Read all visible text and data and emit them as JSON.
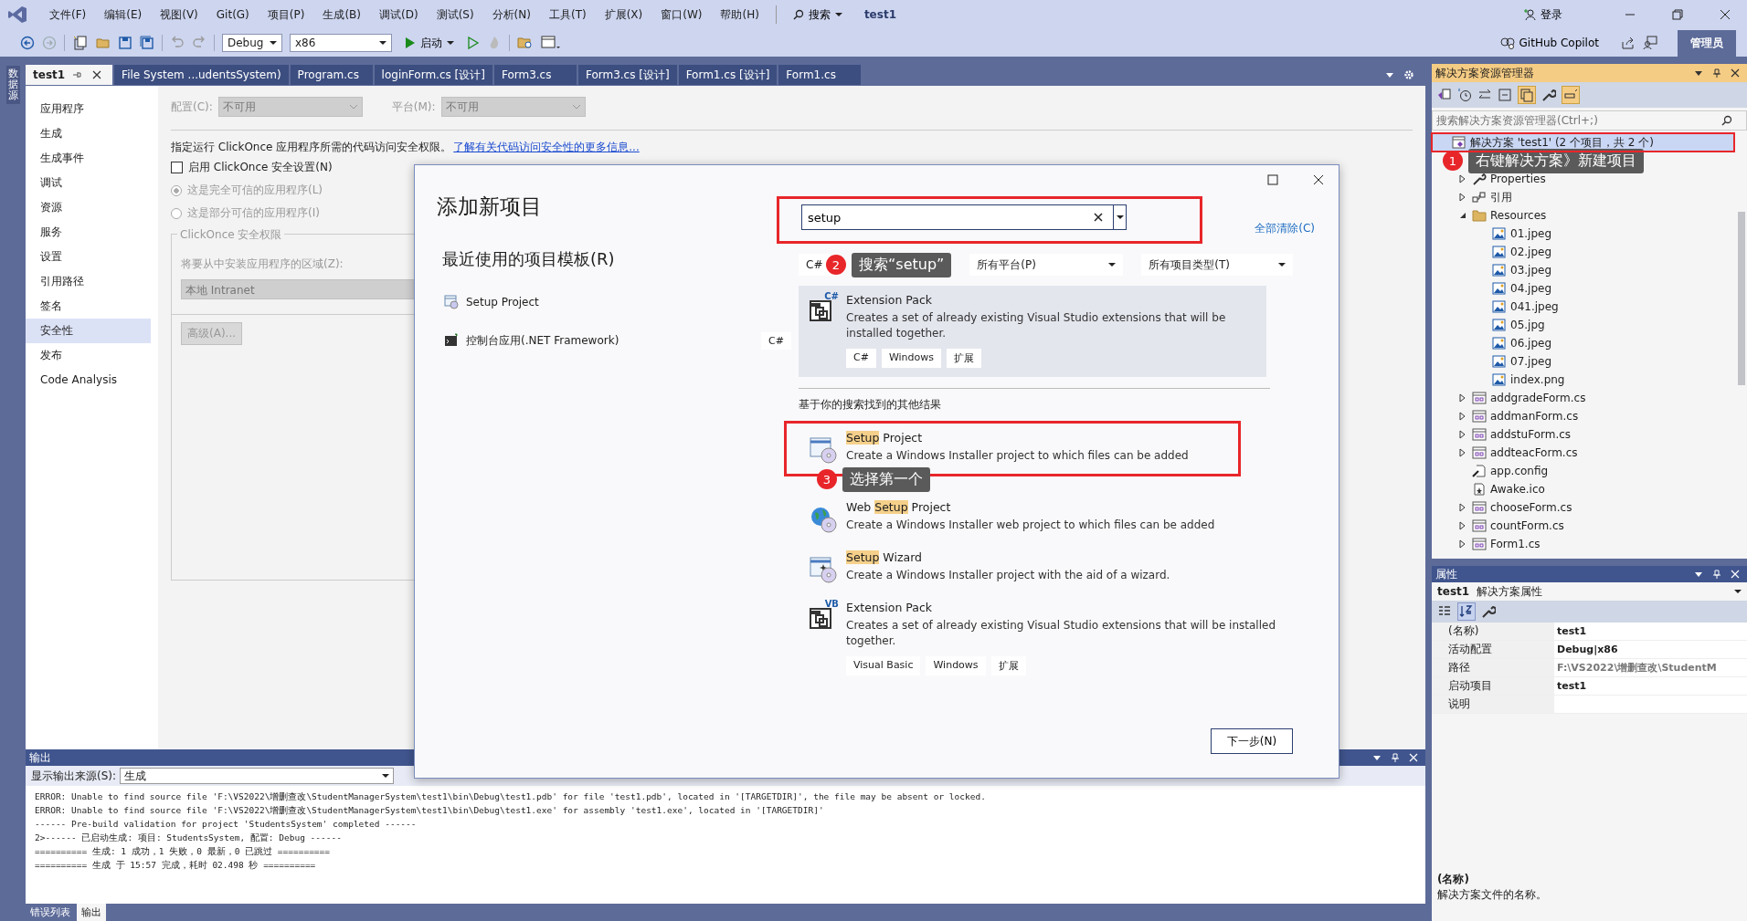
{
  "title_bar": {
    "menu": [
      "文件(F)",
      "编辑(E)",
      "视图(V)",
      "Git(G)",
      "项目(P)",
      "生成(B)",
      "调试(D)",
      "测试(S)",
      "分析(N)",
      "工具(T)",
      "扩展(X)",
      "窗口(W)",
      "帮助(H)"
    ],
    "search": "搜索",
    "solution_name": "test1",
    "sign_in": "登录"
  },
  "toolbar": {
    "configuration": "Debug",
    "platform": "x86",
    "start": "启动",
    "copilot": "GitHub Copilot",
    "admin": "管理员"
  },
  "side_strip": {
    "label": "数据源"
  },
  "document_tabs": [
    {
      "label": "test1",
      "selected": true
    },
    {
      "label": "File System ...udentsSystem)",
      "selected": false
    },
    {
      "label": "Program.cs",
      "selected": false
    },
    {
      "label": "loginForm.cs [设计]",
      "selected": false
    },
    {
      "label": "Form3.cs",
      "selected": false
    },
    {
      "label": "Form3.cs [设计]",
      "selected": false
    },
    {
      "label": "Form1.cs [设计]",
      "selected": false
    },
    {
      "label": "Form1.cs",
      "selected": false
    }
  ],
  "project_properties": {
    "nav": [
      {
        "label": "应用程序",
        "selected": false
      },
      {
        "label": "生成",
        "selected": false
      },
      {
        "label": "生成事件",
        "selected": false
      },
      {
        "label": "调试",
        "selected": false
      },
      {
        "label": "资源",
        "selected": false
      },
      {
        "label": "服务",
        "selected": false
      },
      {
        "label": "设置",
        "selected": false
      },
      {
        "label": "引用路径",
        "selected": false
      },
      {
        "label": "签名",
        "selected": false
      },
      {
        "label": "安全性",
        "selected": true
      },
      {
        "label": "发布",
        "selected": false
      },
      {
        "label": "Code Analysis",
        "selected": false
      }
    ],
    "config_label": "配置(C):",
    "config_value": "不可用",
    "platform_label": "平台(M):",
    "platform_value": "不可用",
    "description": "指定运行 ClickOnce 应用程序所需的代码访问安全权限。",
    "link": "了解有关代码访问安全性的更多信息...",
    "enable_checkbox": {
      "label": "启用 ClickOnce 安全设置(N)",
      "checked": false
    },
    "trust_options": [
      {
        "label": "这是完全可信的应用程序(L)",
        "selected": true
      },
      {
        "label": "这是部分可信的应用程序(I)",
        "selected": false
      }
    ],
    "group_title": "ClickOnce 安全权限",
    "zone_label": "将要从中安装应用程序的区域(Z):",
    "zone_value": "本地 Intranet",
    "advanced_button": "高级(A)..."
  },
  "dialog": {
    "title": "添加新项目",
    "recent_heading": "最近使用的项目模板(R)",
    "recent": [
      {
        "name": "Setup Project",
        "kind": "setup"
      },
      {
        "name": "控制台应用(.NET Framework)",
        "kind": "console",
        "tag": "C#"
      }
    ],
    "search": {
      "value": "setup",
      "annotation": {
        "number": "2",
        "text": "搜索“setup”"
      }
    },
    "clear_all": "全部清除(C)",
    "filters": [
      "C#",
      "所有平台(P)",
      "所有项目类型(T)"
    ],
    "results": [
      {
        "kind": "extension",
        "icon_badge": "C#",
        "prefix": "Extension Pack",
        "description": "Creates a set of already existing Visual Studio extensions that will be installed together.",
        "tags": [
          "C#",
          "Windows",
          "扩展"
        ],
        "selected": true
      }
    ],
    "other_heading": "基于你的搜索找到的其他结果",
    "other_results": [
      {
        "kind": "setup",
        "match": "Setup",
        "suffix": " Project",
        "description": "Create a Windows Installer project to which files can be added",
        "selected": false,
        "annotation": {
          "number": "3",
          "text": "选择第一个"
        }
      },
      {
        "kind": "web",
        "prefix": "Web ",
        "match": "Setup",
        "suffix": " Project",
        "description": "Create a Windows Installer web project to which files can be added",
        "selected": false
      },
      {
        "kind": "wizard",
        "match": "Setup",
        "suffix": " Wizard",
        "description": "Create a Windows Installer project with the aid of a wizard.",
        "selected": false
      },
      {
        "kind": "extension",
        "icon_badge": "VB",
        "prefix": "Extension Pack",
        "description": "Creates a set of already existing Visual Studio extensions that will be installed together.",
        "tags": [
          "Visual Basic",
          "Windows",
          "扩展"
        ],
        "selected": false
      }
    ],
    "next_button": "下一步(N)"
  },
  "solution_explorer": {
    "title": "解决方案资源管理器",
    "search_placeholder": "搜索解决方案资源管理器(Ctrl+;)",
    "annotation": {
      "number": "1",
      "text": "右键解决方案》新建项目"
    },
    "tree": [
      {
        "label": "解决方案 'test1' (2 个项目，共 2 个)",
        "kind": "solution",
        "selected": true,
        "children": [
          {
            "label": "Properties",
            "kind": "properties",
            "expanded": false,
            "selected": false
          },
          {
            "label": "引用",
            "kind": "references",
            "expanded": false,
            "selected": false
          },
          {
            "label": "Resources",
            "kind": "folder",
            "expanded": true,
            "selected": false,
            "children": [
              {
                "label": "01.jpeg",
                "kind": "image",
                "selected": false
              },
              {
                "label": "02.jpeg",
                "kind": "image",
                "selected": false
              },
              {
                "label": "03.jpeg",
                "kind": "image",
                "selected": false
              },
              {
                "label": "04.jpeg",
                "kind": "image",
                "selected": false
              },
              {
                "label": "041.jpeg",
                "kind": "image",
                "selected": false
              },
              {
                "label": "05.jpg",
                "kind": "image",
                "selected": false
              },
              {
                "label": "06.jpeg",
                "kind": "image",
                "selected": false
              },
              {
                "label": "07.jpeg",
                "kind": "image",
                "selected": false
              },
              {
                "label": "index.png",
                "kind": "image",
                "selected": false
              }
            ]
          },
          {
            "label": "addgradeForm.cs",
            "kind": "form",
            "expanded": false,
            "selected": false
          },
          {
            "label": "addmanForm.cs",
            "kind": "form",
            "expanded": false,
            "selected": false
          },
          {
            "label": "addstuForm.cs",
            "kind": "form",
            "expanded": false,
            "selected": false
          },
          {
            "label": "addteacForm.cs",
            "kind": "form",
            "expanded": false,
            "selected": false
          },
          {
            "label": "app.config",
            "kind": "config",
            "selected": false
          },
          {
            "label": "Awake.ico",
            "kind": "icon",
            "selected": false
          },
          {
            "label": "chooseForm.cs",
            "kind": "form",
            "expanded": false,
            "selected": false
          },
          {
            "label": "countForm.cs",
            "kind": "form",
            "expanded": false,
            "selected": false
          },
          {
            "label": "Form1.cs",
            "kind": "form",
            "expanded": false,
            "selected": false
          }
        ]
      }
    ]
  },
  "properties_panel": {
    "title": "属性",
    "object": "test1",
    "object_type": "解决方案属性",
    "rows": [
      {
        "name": "(名称)",
        "value": "test1",
        "disabled": false
      },
      {
        "name": "活动配置",
        "value": "Debug|x86",
        "disabled": false
      },
      {
        "name": "路径",
        "value": "F:\\VS2022\\增删查改\\StudentM",
        "disabled": true
      },
      {
        "name": "启动项目",
        "value": "test1",
        "disabled": false
      },
      {
        "name": "说明"
      }
    ],
    "help_title": "(名称)",
    "help_text": "解决方案文件的名称。"
  },
  "output": {
    "title": "输出",
    "source_label": "显示输出来源(S):",
    "source_value": "生成",
    "lines": [
      "ERROR: Unable to find source file 'F:\\VS2022\\增删查改\\StudentManagerSystem\\test1\\bin\\Debug\\test1.pdb' for file 'test1.pdb', located in '[TARGETDIR]', the file may be absent or locked.",
      "ERROR: Unable to find source file 'F:\\VS2022\\增删查改\\StudentManagerSystem\\test1\\bin\\Debug\\test1.exe' for assembly 'test1.exe', located in '[TARGETDIR]'",
      "------ Pre-build validation for project 'StudentsSystem' completed ------",
      "2>------ 已启动生成: 项目: StudentsSystem, 配置: Debug ------",
      "========== 生成: 1 成功，1 失败，0 最新，0 已跳过 ==========",
      "========== 生成 于 15:57 完成，耗时 02.498 秒 =========="
    ]
  },
  "bottom_tabs": [
    {
      "label": "错误列表",
      "selected": false
    },
    {
      "label": "输出",
      "selected": true
    }
  ]
}
